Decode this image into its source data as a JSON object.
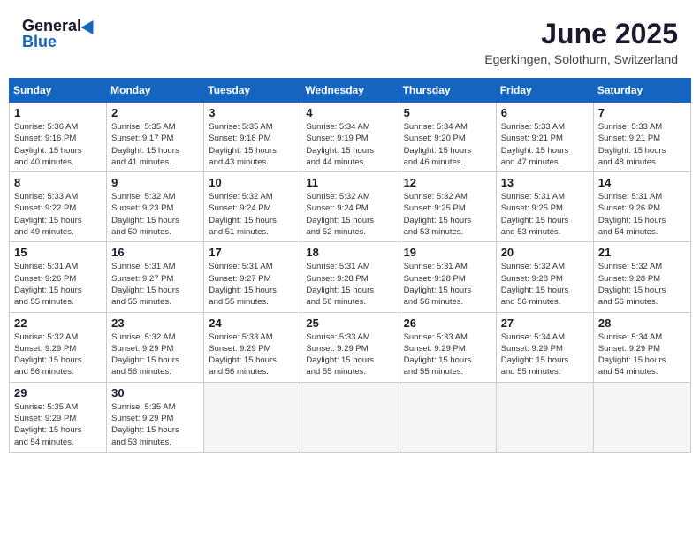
{
  "header": {
    "logo_general": "General",
    "logo_blue": "Blue",
    "month_title": "June 2025",
    "location": "Egerkingen, Solothurn, Switzerland"
  },
  "calendar": {
    "days_of_week": [
      "Sunday",
      "Monday",
      "Tuesday",
      "Wednesday",
      "Thursday",
      "Friday",
      "Saturday"
    ],
    "weeks": [
      [
        {
          "day": "",
          "info": ""
        },
        {
          "day": "2",
          "info": "Sunrise: 5:35 AM\nSunset: 9:17 PM\nDaylight: 15 hours\nand 41 minutes."
        },
        {
          "day": "3",
          "info": "Sunrise: 5:35 AM\nSunset: 9:18 PM\nDaylight: 15 hours\nand 43 minutes."
        },
        {
          "day": "4",
          "info": "Sunrise: 5:34 AM\nSunset: 9:19 PM\nDaylight: 15 hours\nand 44 minutes."
        },
        {
          "day": "5",
          "info": "Sunrise: 5:34 AM\nSunset: 9:20 PM\nDaylight: 15 hours\nand 46 minutes."
        },
        {
          "day": "6",
          "info": "Sunrise: 5:33 AM\nSunset: 9:21 PM\nDaylight: 15 hours\nand 47 minutes."
        },
        {
          "day": "7",
          "info": "Sunrise: 5:33 AM\nSunset: 9:21 PM\nDaylight: 15 hours\nand 48 minutes."
        }
      ],
      [
        {
          "day": "8",
          "info": "Sunrise: 5:33 AM\nSunset: 9:22 PM\nDaylight: 15 hours\nand 49 minutes."
        },
        {
          "day": "9",
          "info": "Sunrise: 5:32 AM\nSunset: 9:23 PM\nDaylight: 15 hours\nand 50 minutes."
        },
        {
          "day": "10",
          "info": "Sunrise: 5:32 AM\nSunset: 9:24 PM\nDaylight: 15 hours\nand 51 minutes."
        },
        {
          "day": "11",
          "info": "Sunrise: 5:32 AM\nSunset: 9:24 PM\nDaylight: 15 hours\nand 52 minutes."
        },
        {
          "day": "12",
          "info": "Sunrise: 5:32 AM\nSunset: 9:25 PM\nDaylight: 15 hours\nand 53 minutes."
        },
        {
          "day": "13",
          "info": "Sunrise: 5:31 AM\nSunset: 9:25 PM\nDaylight: 15 hours\nand 53 minutes."
        },
        {
          "day": "14",
          "info": "Sunrise: 5:31 AM\nSunset: 9:26 PM\nDaylight: 15 hours\nand 54 minutes."
        }
      ],
      [
        {
          "day": "15",
          "info": "Sunrise: 5:31 AM\nSunset: 9:26 PM\nDaylight: 15 hours\nand 55 minutes."
        },
        {
          "day": "16",
          "info": "Sunrise: 5:31 AM\nSunset: 9:27 PM\nDaylight: 15 hours\nand 55 minutes."
        },
        {
          "day": "17",
          "info": "Sunrise: 5:31 AM\nSunset: 9:27 PM\nDaylight: 15 hours\nand 55 minutes."
        },
        {
          "day": "18",
          "info": "Sunrise: 5:31 AM\nSunset: 9:28 PM\nDaylight: 15 hours\nand 56 minutes."
        },
        {
          "day": "19",
          "info": "Sunrise: 5:31 AM\nSunset: 9:28 PM\nDaylight: 15 hours\nand 56 minutes."
        },
        {
          "day": "20",
          "info": "Sunrise: 5:32 AM\nSunset: 9:28 PM\nDaylight: 15 hours\nand 56 minutes."
        },
        {
          "day": "21",
          "info": "Sunrise: 5:32 AM\nSunset: 9:28 PM\nDaylight: 15 hours\nand 56 minutes."
        }
      ],
      [
        {
          "day": "22",
          "info": "Sunrise: 5:32 AM\nSunset: 9:29 PM\nDaylight: 15 hours\nand 56 minutes."
        },
        {
          "day": "23",
          "info": "Sunrise: 5:32 AM\nSunset: 9:29 PM\nDaylight: 15 hours\nand 56 minutes."
        },
        {
          "day": "24",
          "info": "Sunrise: 5:33 AM\nSunset: 9:29 PM\nDaylight: 15 hours\nand 56 minutes."
        },
        {
          "day": "25",
          "info": "Sunrise: 5:33 AM\nSunset: 9:29 PM\nDaylight: 15 hours\nand 55 minutes."
        },
        {
          "day": "26",
          "info": "Sunrise: 5:33 AM\nSunset: 9:29 PM\nDaylight: 15 hours\nand 55 minutes."
        },
        {
          "day": "27",
          "info": "Sunrise: 5:34 AM\nSunset: 9:29 PM\nDaylight: 15 hours\nand 55 minutes."
        },
        {
          "day": "28",
          "info": "Sunrise: 5:34 AM\nSunset: 9:29 PM\nDaylight: 15 hours\nand 54 minutes."
        }
      ],
      [
        {
          "day": "29",
          "info": "Sunrise: 5:35 AM\nSunset: 9:29 PM\nDaylight: 15 hours\nand 54 minutes."
        },
        {
          "day": "30",
          "info": "Sunrise: 5:35 AM\nSunset: 9:29 PM\nDaylight: 15 hours\nand 53 minutes."
        },
        {
          "day": "",
          "info": ""
        },
        {
          "day": "",
          "info": ""
        },
        {
          "day": "",
          "info": ""
        },
        {
          "day": "",
          "info": ""
        },
        {
          "day": "",
          "info": ""
        }
      ]
    ],
    "week1_day1": {
      "day": "1",
      "info": "Sunrise: 5:36 AM\nSunset: 9:16 PM\nDaylight: 15 hours\nand 40 minutes."
    }
  }
}
